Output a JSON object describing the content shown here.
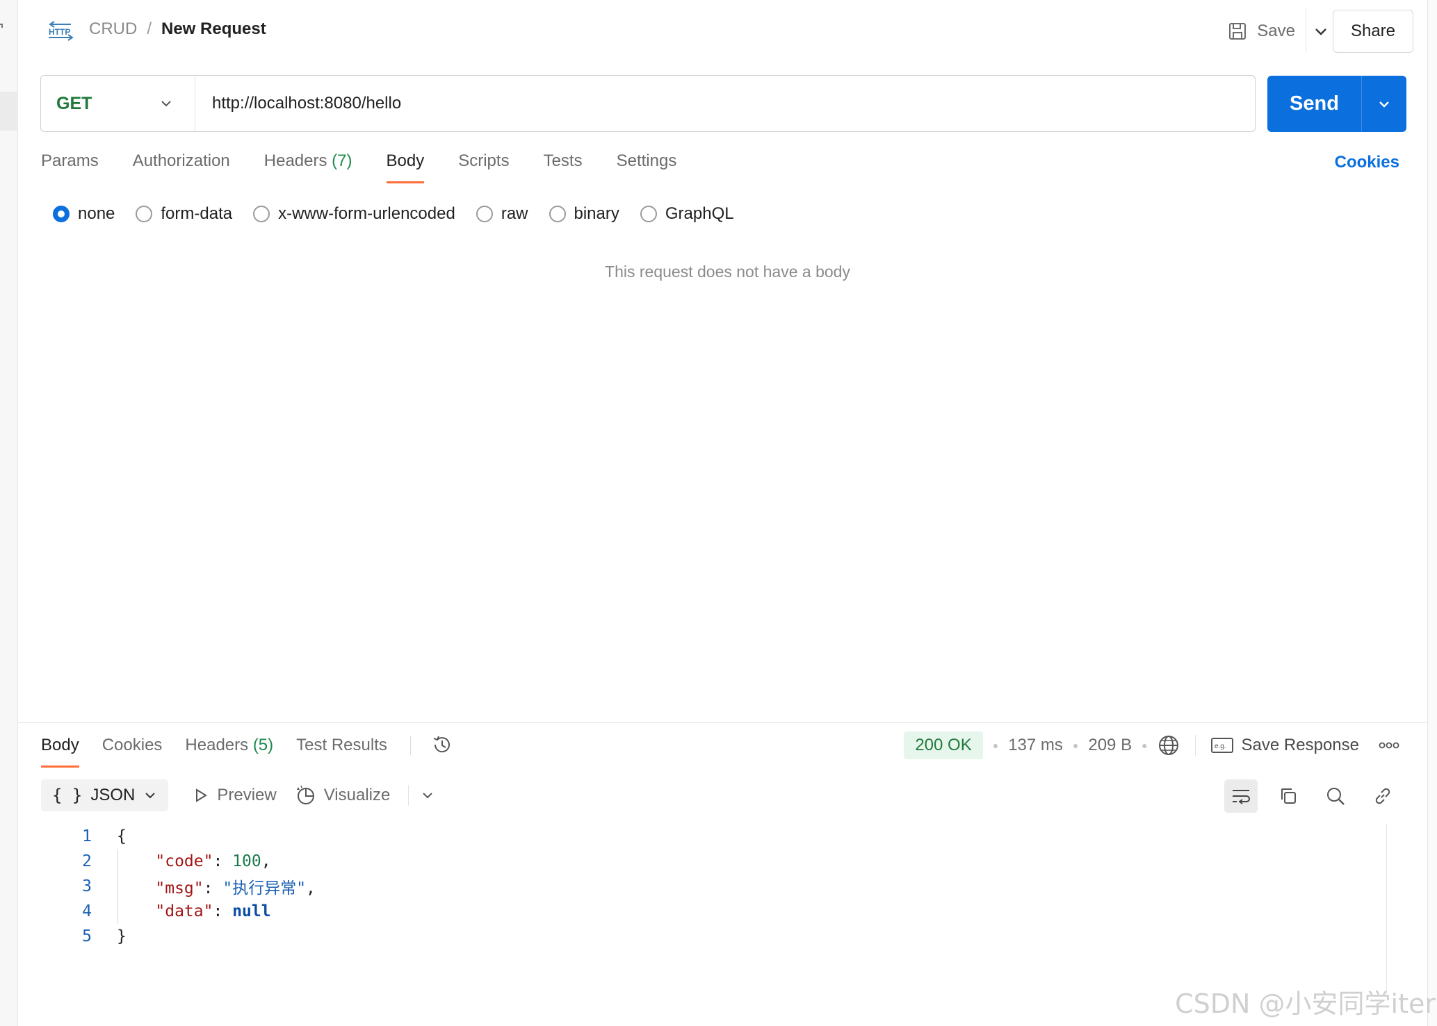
{
  "header": {
    "icon": "http-icon",
    "breadcrumb_parent": "CRUD",
    "breadcrumb_separator": "/",
    "breadcrumb_current": "New Request",
    "save_label": "Save",
    "share_label": "Share"
  },
  "request": {
    "method": "GET",
    "method_color": "#1f7a3a",
    "url": "http://localhost:8080/hello",
    "send_label": "Send",
    "send_color": "#0b6fde"
  },
  "request_tabs": [
    {
      "label": "Params",
      "count": ""
    },
    {
      "label": "Authorization",
      "count": ""
    },
    {
      "label": "Headers",
      "count": "(7)"
    },
    {
      "label": "Body",
      "count": "",
      "active": true
    },
    {
      "label": "Scripts",
      "count": ""
    },
    {
      "label": "Tests",
      "count": ""
    },
    {
      "label": "Settings",
      "count": ""
    }
  ],
  "cookies_link": "Cookies",
  "body_types": [
    {
      "label": "none",
      "checked": true
    },
    {
      "label": "form-data",
      "checked": false
    },
    {
      "label": "x-www-form-urlencoded",
      "checked": false
    },
    {
      "label": "raw",
      "checked": false
    },
    {
      "label": "binary",
      "checked": false
    },
    {
      "label": "GraphQL",
      "checked": false
    }
  ],
  "empty_body_text": "This request does not have a body",
  "response": {
    "tabs": [
      {
        "label": "Body",
        "count": "",
        "active": true
      },
      {
        "label": "Cookies",
        "count": ""
      },
      {
        "label": "Headers",
        "count": "(5)"
      },
      {
        "label": "Test Results",
        "count": ""
      }
    ],
    "status": "200 OK",
    "time": "137 ms",
    "size": "209 B",
    "save_response_label": "Save Response",
    "format_label": "JSON",
    "preview_label": "Preview",
    "visualize_label": "Visualize",
    "code_lines": [
      {
        "n": "1",
        "text": "{"
      },
      {
        "n": "2",
        "key": "\"code\"",
        "sep": ": ",
        "value": "100",
        "vclass": "n",
        "end": ","
      },
      {
        "n": "3",
        "key": "\"msg\"",
        "sep": ": ",
        "value": "\"执行异常\"",
        "vclass": "s",
        "end": ","
      },
      {
        "n": "4",
        "key": "\"data\"",
        "sep": ": ",
        "value": "null",
        "vclass": "kw",
        "end": ""
      },
      {
        "n": "5",
        "text": "}"
      }
    ]
  },
  "watermark": "CSDN @小安同学iter"
}
